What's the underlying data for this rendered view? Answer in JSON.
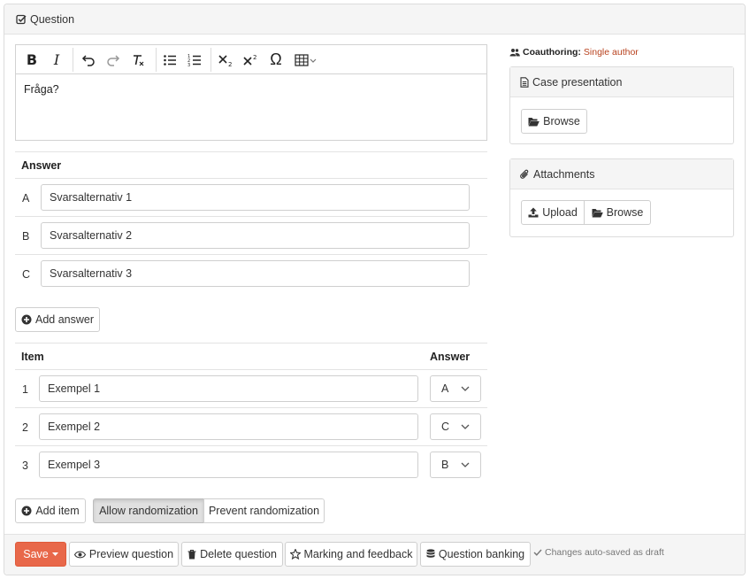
{
  "panel": {
    "title": "Question"
  },
  "editor": {
    "content": "Fråga?",
    "toolbar": [
      {
        "name": "bold-button",
        "label": "B"
      },
      {
        "name": "italic-button",
        "label": "I"
      },
      {
        "name": "undo-button",
        "icon": "undo-icon"
      },
      {
        "name": "redo-button",
        "icon": "redo-icon"
      },
      {
        "name": "remove-format-button",
        "icon": "clear-format-icon"
      },
      {
        "name": "bulleted-list-button",
        "icon": "bulleted-list-icon"
      },
      {
        "name": "numbered-list-button",
        "icon": "numbered-list-icon"
      },
      {
        "name": "subscript-button",
        "icon": "subscript-icon"
      },
      {
        "name": "superscript-button",
        "icon": "superscript-icon"
      },
      {
        "name": "special-character-button",
        "label": "Ω"
      },
      {
        "name": "table-button",
        "icon": "table-icon"
      }
    ]
  },
  "answers": {
    "header": "Answer",
    "rows": [
      {
        "letter": "A",
        "value": "Svarsalternativ 1"
      },
      {
        "letter": "B",
        "value": "Svarsalternativ 2"
      },
      {
        "letter": "C",
        "value": "Svarsalternativ 3"
      }
    ],
    "add_label": "Add answer"
  },
  "items": {
    "item_header": "Item",
    "answer_header": "Answer",
    "rows": [
      {
        "number": "1",
        "value": "Exempel 1",
        "answer": "A"
      },
      {
        "number": "2",
        "value": "Exempel 2",
        "answer": "C"
      },
      {
        "number": "3",
        "value": "Exempel 3",
        "answer": "B"
      }
    ],
    "add_label": "Add item",
    "allow_randomization": "Allow randomization",
    "prevent_randomization": "Prevent randomization"
  },
  "sidebar": {
    "coauthoring_label": "Coauthoring:",
    "coauthoring_value": "Single author",
    "case_presentation": {
      "title": "Case presentation",
      "browse_label": "Browse"
    },
    "attachments": {
      "title": "Attachments",
      "upload_label": "Upload",
      "browse_label": "Browse"
    }
  },
  "footer": {
    "save_label": "Save",
    "preview_label": "Preview question",
    "delete_label": "Delete question",
    "marking_label": "Marking and feedback",
    "banking_label": "Question banking",
    "autosave_status": "Changes auto-saved as draft"
  },
  "colors": {
    "save_button": "#e8684a",
    "coauthoring_value": "#b8421e",
    "panel_heading_bg": "#f5f5f5"
  }
}
